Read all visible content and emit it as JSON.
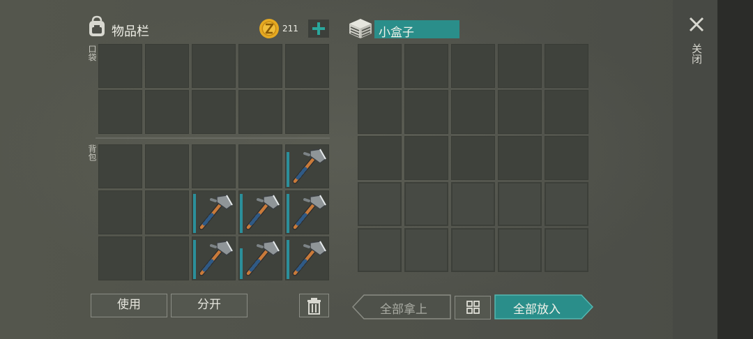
{
  "inventory": {
    "title": "物品栏",
    "coins": "211",
    "pocket_label": "口袋",
    "backpack_label": "背包",
    "pocket_slots": [
      {
        "item": null
      },
      {
        "item": null
      },
      {
        "item": null
      },
      {
        "item": null
      },
      {
        "item": null
      },
      {
        "item": null
      },
      {
        "item": null
      },
      {
        "item": null
      },
      {
        "item": null
      },
      {
        "item": null
      }
    ],
    "backpack_slots": [
      {
        "item": null
      },
      {
        "item": null
      },
      {
        "item": null
      },
      {
        "item": null
      },
      {
        "item": "axe-icon",
        "durability": 0.85
      },
      {
        "item": null
      },
      {
        "item": null
      },
      {
        "item": "axe-icon",
        "durability": 0.95
      },
      {
        "item": "axe-icon",
        "durability": 0.95
      },
      {
        "item": "axe-icon",
        "durability": 0.95
      },
      {
        "item": null
      },
      {
        "item": null
      },
      {
        "item": "axe-icon",
        "durability": 0.95
      },
      {
        "item": "axe-icon",
        "durability": 0.75
      },
      {
        "item": "axe-icon",
        "durability": 0.95
      }
    ],
    "use_label": "使用",
    "split_label": "分开"
  },
  "container": {
    "title": "小盒子",
    "take_all_label": "全部拿上",
    "put_all_label": "全部放入"
  },
  "close_label": "关闭",
  "colors": {
    "accent_teal": "#2a8e8a",
    "slot": "#3f423c",
    "durability": "#2b8f9b",
    "coin": "#e5a921"
  }
}
